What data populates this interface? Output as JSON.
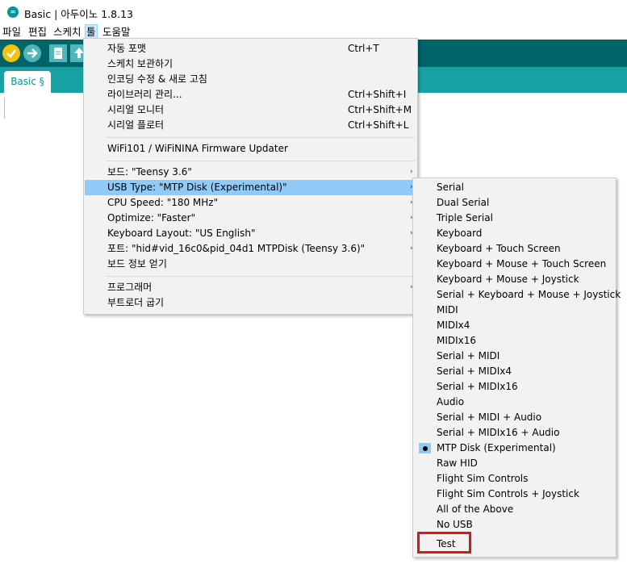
{
  "window": {
    "title": "Basic | 아두이노 1.8.13",
    "icon": "arduino-icon"
  },
  "menubar": {
    "items": [
      "파일",
      "편집",
      "스케치",
      "툴",
      "도움말"
    ],
    "active": "툴"
  },
  "toolbar": {
    "buttons": [
      "verify-icon",
      "upload-icon",
      "new-icon",
      "open-icon"
    ],
    "accent": "#006468",
    "verify_color": "#f1c40f"
  },
  "tabs": [
    {
      "label": "Basic §"
    }
  ],
  "tools_menu": {
    "items": [
      {
        "label": "자동 포맷",
        "shortcut": "Ctrl+T"
      },
      {
        "label": "스케치 보관하기",
        "shortcut": ""
      },
      {
        "label": "인코딩 수정 & 새로 고침",
        "shortcut": ""
      },
      {
        "label": "라이브러리 관리...",
        "shortcut": "Ctrl+Shift+I"
      },
      {
        "label": "시리얼 모니터",
        "shortcut": "Ctrl+Shift+M"
      },
      {
        "label": "시리얼 플로터",
        "shortcut": "Ctrl+Shift+L"
      },
      {
        "label": "WiFi101 / WiFiNINA Firmware Updater",
        "shortcut": ""
      },
      {
        "label": "보드: \"Teensy 3.6\"",
        "shortcut": ""
      },
      {
        "label": "USB Type: \"MTP Disk (Experimental)\"",
        "shortcut": ""
      },
      {
        "label": "CPU Speed: \"180 MHz\"",
        "shortcut": ""
      },
      {
        "label": "Optimize: \"Faster\"",
        "shortcut": ""
      },
      {
        "label": "Keyboard Layout: \"US English\"",
        "shortcut": ""
      },
      {
        "label": "포트: \"hid#vid_16c0&pid_04d1 MTPDisk (Teensy 3.6)\"",
        "shortcut": ""
      },
      {
        "label": "보드 정보 얻기",
        "shortcut": ""
      },
      {
        "label": "프로그래머",
        "shortcut": ""
      },
      {
        "label": "부트로더 굽기",
        "shortcut": ""
      }
    ],
    "highlighted": "USB Type: \"MTP Disk (Experimental)\"",
    "highlight_color": "#91c9f7"
  },
  "usb_type_submenu": {
    "items": [
      "Serial",
      "Dual Serial",
      "Triple Serial",
      "Keyboard",
      "Keyboard + Touch Screen",
      "Keyboard + Mouse + Touch Screen",
      "Keyboard + Mouse + Joystick",
      "Serial + Keyboard + Mouse + Joystick",
      "MIDI",
      "MIDIx4",
      "MIDIx16",
      "Serial + MIDI",
      "Serial + MIDIx4",
      "Serial + MIDIx16",
      "Audio",
      "Serial + MIDI + Audio",
      "Serial + MIDIx16 + Audio",
      "MTP Disk (Experimental)",
      "Raw HID",
      "Flight Sim Controls",
      "Flight Sim Controls + Joystick",
      "All of the Above",
      "No USB",
      "Test"
    ],
    "selected": "MTP Disk (Experimental)",
    "annotated": "Test",
    "annotation_color": "#e0101e"
  }
}
